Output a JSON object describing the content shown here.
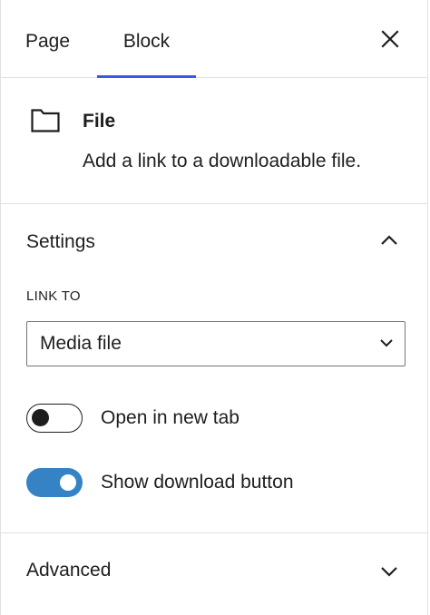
{
  "tabs": {
    "page_label": "Page",
    "block_label": "Block",
    "active": "Block"
  },
  "block_card": {
    "icon": "folder-icon",
    "title": "File",
    "description": "Add a link to a downloadable file."
  },
  "settings": {
    "title": "Settings",
    "expanded": true,
    "link_to_label": "LINK TO",
    "link_to_value": "Media file",
    "open_new_tab": {
      "label": "Open in new tab",
      "checked": false
    },
    "show_download_button": {
      "label": "Show download button",
      "checked": true
    }
  },
  "advanced": {
    "title": "Advanced",
    "expanded": false
  },
  "colors": {
    "accent": "#3858e9",
    "toggle_on": "#3582c4",
    "text": "#1e1e1e",
    "border": "#e0e0e0"
  }
}
